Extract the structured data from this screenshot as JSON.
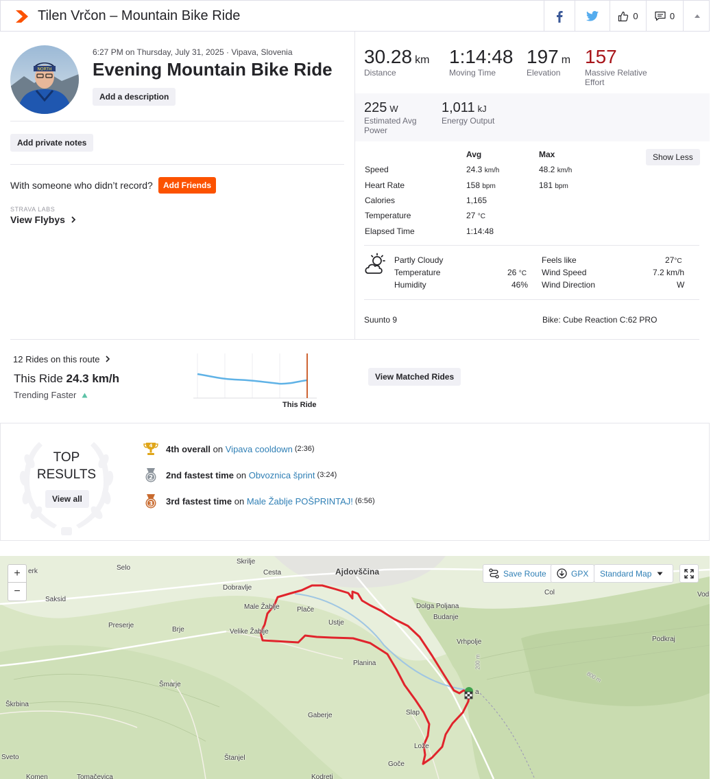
{
  "header": {
    "title": "Tilen Vrčon – Mountain Bike Ride",
    "kudos_count": "0",
    "comments_count": "0"
  },
  "activity": {
    "meta": "6:27 PM on Thursday, July 31, 2025 · Vipava, Slovenia",
    "title": "Evening Mountain Bike Ride",
    "add_description": "Add a description",
    "add_private_notes": "Add private notes",
    "with_someone": "With someone who didn’t record?",
    "add_friends": "Add Friends",
    "labs": "STRAVA LABS",
    "view_flybys": "View Flybys"
  },
  "stats": {
    "distance": {
      "value": "30.28",
      "unit": "km",
      "label": "Distance"
    },
    "moving_time": {
      "value": "1:14:48",
      "label": "Moving Time"
    },
    "elevation": {
      "value": "197",
      "unit": "m",
      "label": "Elevation"
    },
    "relative_effort": {
      "value": "157",
      "label_1": "Massive Relative",
      "label_2": "Effort"
    },
    "power": {
      "value": "225",
      "unit": "W",
      "label_1": "Estimated Avg",
      "label_2": "Power"
    },
    "energy": {
      "value": "1,011",
      "unit": "kJ",
      "label": "Energy Output"
    }
  },
  "details": {
    "avg_header": "Avg",
    "max_header": "Max",
    "show_less": "Show Less",
    "rows": [
      {
        "label": "Speed",
        "avg": "24.3",
        "avg_unit": "km/h",
        "max": "48.2",
        "max_unit": "km/h"
      },
      {
        "label": "Heart Rate",
        "avg": "158",
        "avg_unit": "bpm",
        "max": "181",
        "max_unit": "bpm"
      },
      {
        "label": "Calories",
        "avg": "1,165",
        "avg_unit": "",
        "max": "",
        "max_unit": ""
      },
      {
        "label": "Temperature",
        "avg": "27",
        "avg_unit": "°C",
        "max": "",
        "max_unit": ""
      },
      {
        "label": "Elapsed Time",
        "avg": "1:14:48",
        "avg_unit": "",
        "max": "",
        "max_unit": ""
      }
    ]
  },
  "weather": {
    "condition": "Partly Cloudy",
    "temperature_label": "Temperature",
    "temperature": "26",
    "temperature_unit": "°C",
    "humidity_label": "Humidity",
    "humidity": "46%",
    "feels_like_label": "Feels like",
    "feels_like": "27",
    "feels_like_unit": "°C",
    "wind_speed_label": "Wind Speed",
    "wind_speed": "7.2 km/h",
    "wind_direction_label": "Wind Direction",
    "wind_direction": "W"
  },
  "gear": {
    "device": "Suunto 9",
    "bike": "Bike: Cube Reaction C:62 PRO"
  },
  "route": {
    "rides_link": "12 Rides on this route",
    "this_ride_prefix": "This Ride",
    "this_ride_speed": "24.3 km/h",
    "trending": "Trending Faster",
    "chart_label": "This Ride",
    "view_matched": "View Matched Rides"
  },
  "top_results": {
    "title_1": "TOP",
    "title_2": "RESULTS",
    "view_all": "View all",
    "items": [
      {
        "rank_badge": "4",
        "rank": "4th overall",
        "on": "on",
        "segment": "Vipava cooldown",
        "time": "(2:36)",
        "color": "#e0a61a"
      },
      {
        "rank_badge": "2",
        "rank": "2nd fastest time",
        "on": "on",
        "segment": "Obvoznica šprint",
        "time": "(3:24)",
        "color": "#8b939b"
      },
      {
        "rank_badge": "3",
        "rank": "3rd fastest time",
        "on": "on",
        "segment": "Male Žablje POŠPRINTAJ!",
        "time": "(6:56)",
        "color": "#c86a2e"
      }
    ]
  },
  "map": {
    "save_route": "Save Route",
    "gpx": "GPX",
    "map_type": "Standard Map",
    "zoom_in": "+",
    "zoom_out": "−",
    "places": {
      "ajdovscina": "Ajdovščina",
      "selo": "Selo",
      "skrilje": "Skrilje",
      "cesta": "Cesta",
      "dobravlje": "Dobravlje",
      "saksid": "Saksid",
      "male_zablje": "Male Žablje",
      "plače": "Plače",
      "velike_zablje": "Velike Žablje",
      "ustje": "Ustje",
      "preserje": "Preserje",
      "brje": "Brje",
      "dolga_poljana": "Dolga Poljana",
      "budanje": "Budanje",
      "col": "Col",
      "vodi": "Vodi",
      "podkraj": "Podkraj",
      "vrhpolje": "Vrhpolje",
      "planina": "Planina",
      "smarje": "Šmarje",
      "skrbina": "Škrbina",
      "gaberje": "Gaberje",
      "slap": "Slap",
      "loze": "Lože",
      "sveto": "Sveto",
      "stanjel": "Štanjel",
      "goce": "Goče",
      "komen": "Komen",
      "tomacevica": "Tomačevica",
      "kodreti": "Kodreti",
      "erk": "erk",
      "vipava": "a",
      "alt_200": "200 m",
      "alt_800": "800 m"
    }
  },
  "colors": {
    "brand": "#fc5200",
    "route": "#e0242c",
    "relative_effort": "#a8151a",
    "link": "#2f7fb5"
  }
}
